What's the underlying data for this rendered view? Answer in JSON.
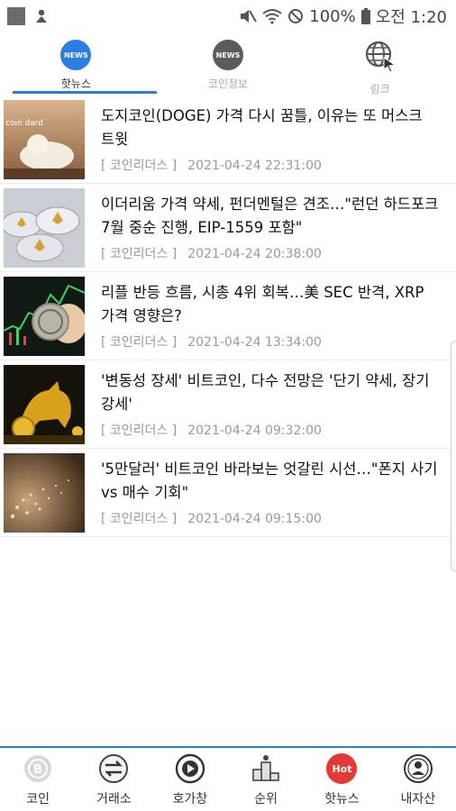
{
  "status_bar": {
    "battery": "100%",
    "time": "오전 1:20"
  },
  "top_tabs": [
    {
      "label": "핫뉴스",
      "icon": "news-icon",
      "active": true
    },
    {
      "label": "코인정보",
      "icon": "news-icon",
      "active": false
    },
    {
      "label": "링크",
      "icon": "globe-cursor-icon",
      "active": false
    }
  ],
  "news": [
    {
      "title": "도지코인(DOGE) 가격 다시 꿈틀, 이유는 또 머스크 트윗",
      "source": "[ 코인리더스 ]",
      "date": "2021-04-24 22:31:00",
      "thumb_text": "coin dard"
    },
    {
      "title": "이더리움 가격 약세, 펀더멘털은 견조…\"런던 하드포크 7월 중순 진행, EIP-1559 포함\"",
      "source": "[ 코인리더스 ]",
      "date": "2021-04-24 20:38:00"
    },
    {
      "title": "리플 반등 흐름, 시총 4위 회복…美 SEC 반격, XRP 가격 영향은?",
      "source": "[ 코인리더스 ]",
      "date": "2021-04-24 13:34:00"
    },
    {
      "title": "'변동성 장세' 비트코인, 다수 전망은 '단기 약세, 장기 강세'",
      "source": "[ 코인리더스 ]",
      "date": "2021-04-24 09:32:00"
    },
    {
      "title": "'5만달러' 비트코인 바라보는 엇갈린 시선…\"폰지 사기 vs 매수 기회\"",
      "source": "[ 코인리더스 ]",
      "date": "2021-04-24 09:15:00"
    }
  ],
  "bottom_nav": [
    {
      "label": "코인",
      "icon": "coin-icon"
    },
    {
      "label": "거래소",
      "icon": "exchange-icon"
    },
    {
      "label": "호가창",
      "icon": "orderbook-icon"
    },
    {
      "label": "순위",
      "icon": "ranking-icon"
    },
    {
      "label": "핫뉴스",
      "icon": "hot-news-icon",
      "badge": "Hot"
    },
    {
      "label": "내자산",
      "icon": "my-assets-icon"
    }
  ],
  "colors": {
    "accent": "#2c7bd6",
    "hot_badge": "#e53935",
    "meta_text": "#9a9a9a"
  }
}
